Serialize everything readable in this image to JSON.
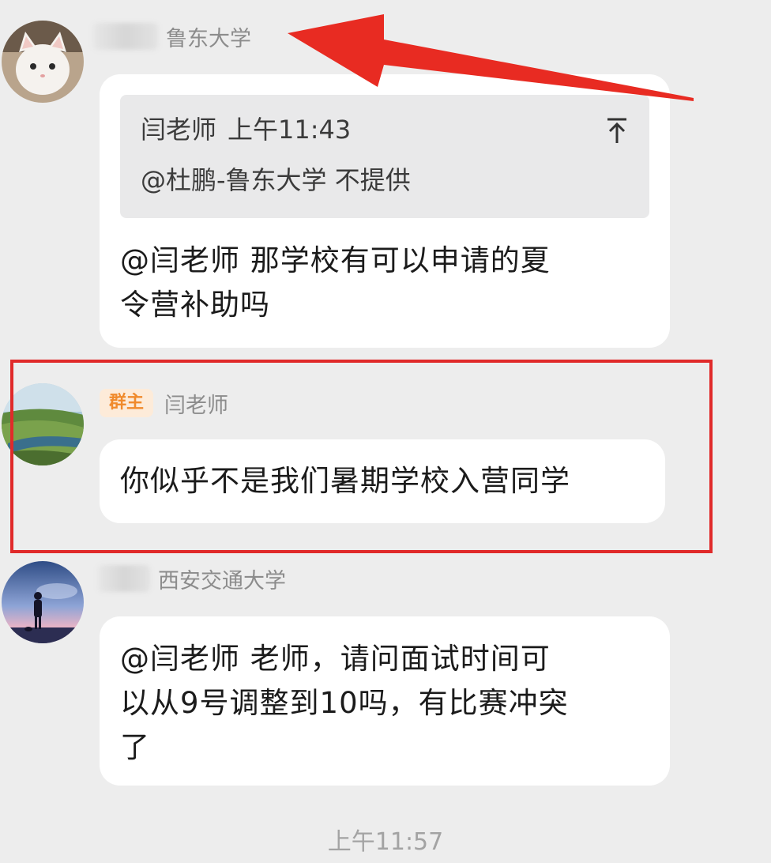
{
  "messages": [
    {
      "sender_school": "鲁东大学",
      "quote": {
        "author": "闫老师",
        "time": "上午11:43",
        "text": "@杜鹏-鲁东大学 不提供"
      },
      "text_line1": "@闫老师 那学校有可以申请的夏",
      "text_line2": "令营补助吗"
    },
    {
      "badge": "群主",
      "sender_name": "闫老师",
      "text": "你似乎不是我们暑期学校入营同学"
    },
    {
      "sender_school": "西安交通大学",
      "text_line1": "@闫老师 老师，请问面试时间可",
      "text_line2": "以从9号调整到10吗，有比赛冲突",
      "text_line3": "了"
    }
  ],
  "timestamp": "上午11:57",
  "colors": {
    "background": "#ededed",
    "bubble": "#ffffff",
    "quote_bg": "#e9e9ea",
    "badge_bg": "#fdebd9",
    "badge_text": "#f08a2c",
    "annotation_red": "#e02a2a"
  },
  "icons": {
    "quote_jump": "arrow-up-to-top-icon",
    "annotation_arrow": "red-arrow-annotation"
  }
}
